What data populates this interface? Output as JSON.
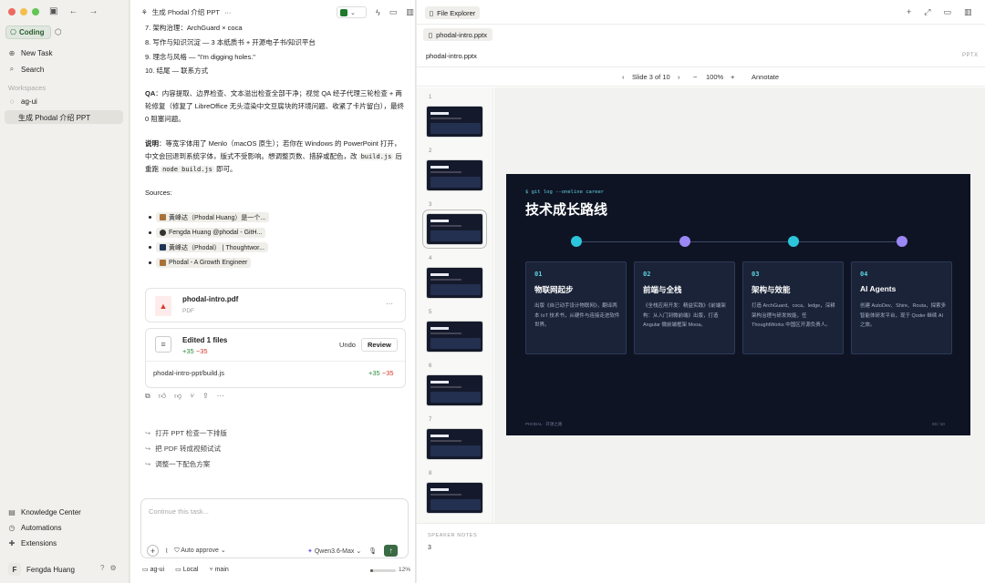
{
  "sidebar": {
    "mode_label": "Coding",
    "new_task": "New Task",
    "search": "Search",
    "workspaces_label": "Workspaces",
    "workspace": "ag-ui",
    "active_task": "生成 Phodal 介绍 PPT",
    "knowledge": "Knowledge Center",
    "automations": "Automations",
    "extensions": "Extensions",
    "user_initial": "F",
    "user_name": "Fengda Huang"
  },
  "chat": {
    "title": "生成 Phodal 介绍 PPT",
    "more": "···",
    "list": [
      "7. 架构治理：ArchGuard × coca",
      "8. 写作与知识沉淀 — 3 本纸质书 + 开源电子书/知识平台",
      "9. 理念与风格 — \"I'm digging holes.\"",
      "10. 结尾 — 联系方式"
    ],
    "qa_label": "QA",
    "qa_text": "：内容提取、边界检查、文本溢出检查全部干净；视觉 QA 经子代理三轮检查 + 两轮修复（修复了 LibreOffice 无头渲染中文豆腐块的环境问题、收紧了卡片留白），最终 0 阻塞问题。",
    "note_label": "说明",
    "note_text1": "：等宽字体用了 Menlo（macOS 原生）；若你在 Windows 的 PowerPoint 打开，中文会回退到系统字体，版式不受影响。想调整页数、措辞或配色，改 ",
    "note_code1": "build.js",
    "note_text2": " 后重跑 ",
    "note_code2": "node build.js",
    "note_text3": " 即可。",
    "sources_label": "Sources:",
    "sources": [
      "黄峰达（Phodal Huang）是一个...",
      "Fengda Huang @phodal - GitH...",
      "黄峰达（Phodal） | Thoughtwor...",
      "Phodal - A Growth Engineer"
    ],
    "file_name": "phodal-intro.pdf",
    "file_type": "PDF",
    "file_more": "···",
    "edited_title": "Edited 1 files",
    "edited_add": "+35",
    "edited_del": "−35",
    "undo": "Undo",
    "review": "Review",
    "edited_path": "phodal-intro-ppt/build.js",
    "edit_add": "+35",
    "edit_del": "−35",
    "suggestions": [
      "打开 PPT 检查一下排版",
      "把 PDF 转成视频试试",
      "调整一下配色方案"
    ],
    "composer_placeholder": "Continue this task...",
    "auto_approve": "Auto approve",
    "model": "Qwen3.6-Max",
    "status_branch_repo": "ag-ui",
    "status_local": "Local",
    "status_branch": "main",
    "context_pct": "12%",
    "context_fraction": 0.12
  },
  "panel": {
    "tab": "File Explorer",
    "file_tab": "phodal-intro.pptx",
    "file_name": "phodal-intro.pptx",
    "file_type": "PPTX",
    "slide_indicator": "Slide 3 of 10",
    "zoom": "100%",
    "annotate": "Annotate",
    "thumb_numbers": [
      "1",
      "2",
      "3",
      "4",
      "5",
      "6",
      "7",
      "8"
    ],
    "speaker_label": "SPEAKER NOTES",
    "speaker_value": "3"
  },
  "slide": {
    "tag": "$ git log --oneline career",
    "title": "技术成长路线",
    "node_colors": [
      "#2cc6dc",
      "#9b87f5",
      "#2cc6dc",
      "#9b87f5"
    ],
    "cards": [
      {
        "no": "01",
        "title": "物联网起步",
        "desc": "出版《自己动手设计物联网》，翻译两本 IoT 技术书，从硬件与连接走进软件世界。"
      },
      {
        "no": "02",
        "title": "前端与全栈",
        "desc": "《全栈应用开发：精益实践》《前端架构：从入门到微前端》出版，打造 Angular 微前端框架 Mooa。"
      },
      {
        "no": "03",
        "title": "架构与效能",
        "desc": "打造 ArchGuard、coca、ledge，深耕架构治理与研发效能，任 ThoughtWorks 中国区开源负责人。"
      },
      {
        "no": "04",
        "title": "AI Agents",
        "desc": "创建 AutoDev、Shire、Routa，探索多智能体研发平台，现于 Qoder 继续 AI 之旅。"
      }
    ],
    "footer": "PHODAL · 开源之路",
    "page": "03 / 10"
  }
}
